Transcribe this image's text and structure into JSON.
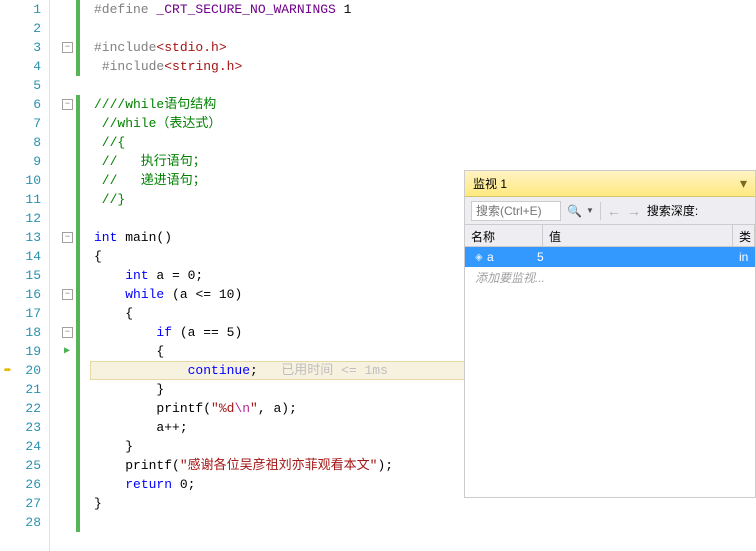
{
  "break_line": 20,
  "code": [
    {
      "n": 1,
      "sq": 0,
      "seg": [
        {
          "c": "pp",
          "t": "#define"
        },
        {
          "c": "",
          "t": " "
        },
        {
          "c": "mac",
          "t": "_CRT_SECURE_NO_WARNINGS"
        },
        {
          "c": "",
          "t": " 1"
        }
      ]
    },
    {
      "n": 2,
      "sq": 0,
      "seg": []
    },
    {
      "n": 3,
      "sq": 1,
      "seg": [
        {
          "c": "pp",
          "t": "#include"
        },
        {
          "c": "str",
          "t": "<stdio.h>"
        }
      ]
    },
    {
      "n": 4,
      "sq": 0,
      "seg": [
        {
          "c": "",
          "t": " "
        },
        {
          "c": "pp",
          "t": "#include"
        },
        {
          "c": "str",
          "t": "<string.h>"
        }
      ]
    },
    {
      "n": 5,
      "sq": 0,
      "seg": []
    },
    {
      "n": 6,
      "sq": 1,
      "seg": [
        {
          "c": "com",
          "t": "////while语句结构"
        }
      ]
    },
    {
      "n": 7,
      "sq": 0,
      "seg": [
        {
          "c": "com",
          "t": " //while（表达式）"
        }
      ]
    },
    {
      "n": 8,
      "sq": 0,
      "seg": [
        {
          "c": "com",
          "t": " //{"
        }
      ]
    },
    {
      "n": 9,
      "sq": 0,
      "seg": [
        {
          "c": "com",
          "t": " //   执行语句；"
        }
      ]
    },
    {
      "n": 10,
      "sq": 0,
      "seg": [
        {
          "c": "com",
          "t": " //   递进语句；"
        }
      ]
    },
    {
      "n": 11,
      "sq": 0,
      "seg": [
        {
          "c": "com",
          "t": " //}"
        }
      ]
    },
    {
      "n": 12,
      "sq": 0,
      "seg": []
    },
    {
      "n": 13,
      "sq": 1,
      "seg": [
        {
          "c": "kw",
          "t": "int"
        },
        {
          "c": "",
          "t": " main()"
        }
      ]
    },
    {
      "n": 14,
      "sq": 0,
      "seg": [
        {
          "c": "",
          "t": "{"
        }
      ]
    },
    {
      "n": 15,
      "sq": 0,
      "seg": [
        {
          "c": "",
          "t": "    "
        },
        {
          "c": "kw",
          "t": "int"
        },
        {
          "c": "",
          "t": " a = 0;"
        }
      ]
    },
    {
      "n": 16,
      "sq": 1,
      "seg": [
        {
          "c": "",
          "t": "    "
        },
        {
          "c": "kw",
          "t": "while"
        },
        {
          "c": "",
          "t": " (a <= 10)"
        }
      ]
    },
    {
      "n": 17,
      "sq": 0,
      "seg": [
        {
          "c": "",
          "t": "    {"
        }
      ]
    },
    {
      "n": 18,
      "sq": 1,
      "seg": [
        {
          "c": "",
          "t": "        "
        },
        {
          "c": "kw",
          "t": "if"
        },
        {
          "c": "",
          "t": " (a == 5)"
        }
      ]
    },
    {
      "n": 19,
      "sq": 0,
      "run": 1,
      "seg": [
        {
          "c": "",
          "t": "        {"
        }
      ]
    },
    {
      "n": 20,
      "sq": 0,
      "hl": 1,
      "seg": [
        {
          "c": "",
          "t": "            "
        },
        {
          "c": "kw",
          "t": "continue"
        },
        {
          "c": "",
          "t": ";   "
        },
        {
          "c": "hint",
          "t": "已用时间 <= 1ms"
        }
      ]
    },
    {
      "n": 21,
      "sq": 0,
      "seg": [
        {
          "c": "",
          "t": "        }"
        }
      ]
    },
    {
      "n": 22,
      "sq": 0,
      "seg": [
        {
          "c": "",
          "t": "        printf("
        },
        {
          "c": "str",
          "t": "\"%d"
        },
        {
          "c": "esc",
          "t": "\\n"
        },
        {
          "c": "str",
          "t": "\""
        },
        {
          "c": "",
          "t": ", a);"
        }
      ]
    },
    {
      "n": 23,
      "sq": 0,
      "seg": [
        {
          "c": "",
          "t": "        a++;"
        }
      ]
    },
    {
      "n": 24,
      "sq": 0,
      "seg": [
        {
          "c": "",
          "t": "    }"
        }
      ]
    },
    {
      "n": 25,
      "sq": 0,
      "seg": [
        {
          "c": "",
          "t": "    printf("
        },
        {
          "c": "str",
          "t": "\"感谢各位吴彦祖刘亦菲观看本文\""
        },
        {
          "c": "",
          "t": ");"
        }
      ]
    },
    {
      "n": 26,
      "sq": 0,
      "seg": [
        {
          "c": "",
          "t": "    "
        },
        {
          "c": "kw",
          "t": "return"
        },
        {
          "c": "",
          "t": " 0;"
        }
      ]
    },
    {
      "n": 27,
      "sq": 0,
      "seg": [
        {
          "c": "",
          "t": "}"
        }
      ]
    },
    {
      "n": 28,
      "sq": 0,
      "seg": []
    }
  ],
  "watch": {
    "title": "监视 1",
    "search_placeholder": "搜索(Ctrl+E)",
    "depth_label": "搜索深度:",
    "headers": {
      "name": "名称",
      "value": "值",
      "type": "类"
    },
    "rows": [
      {
        "name": "a",
        "value": "5",
        "type": "int",
        "sel": true
      }
    ],
    "add_hint": "添加要监视..."
  }
}
